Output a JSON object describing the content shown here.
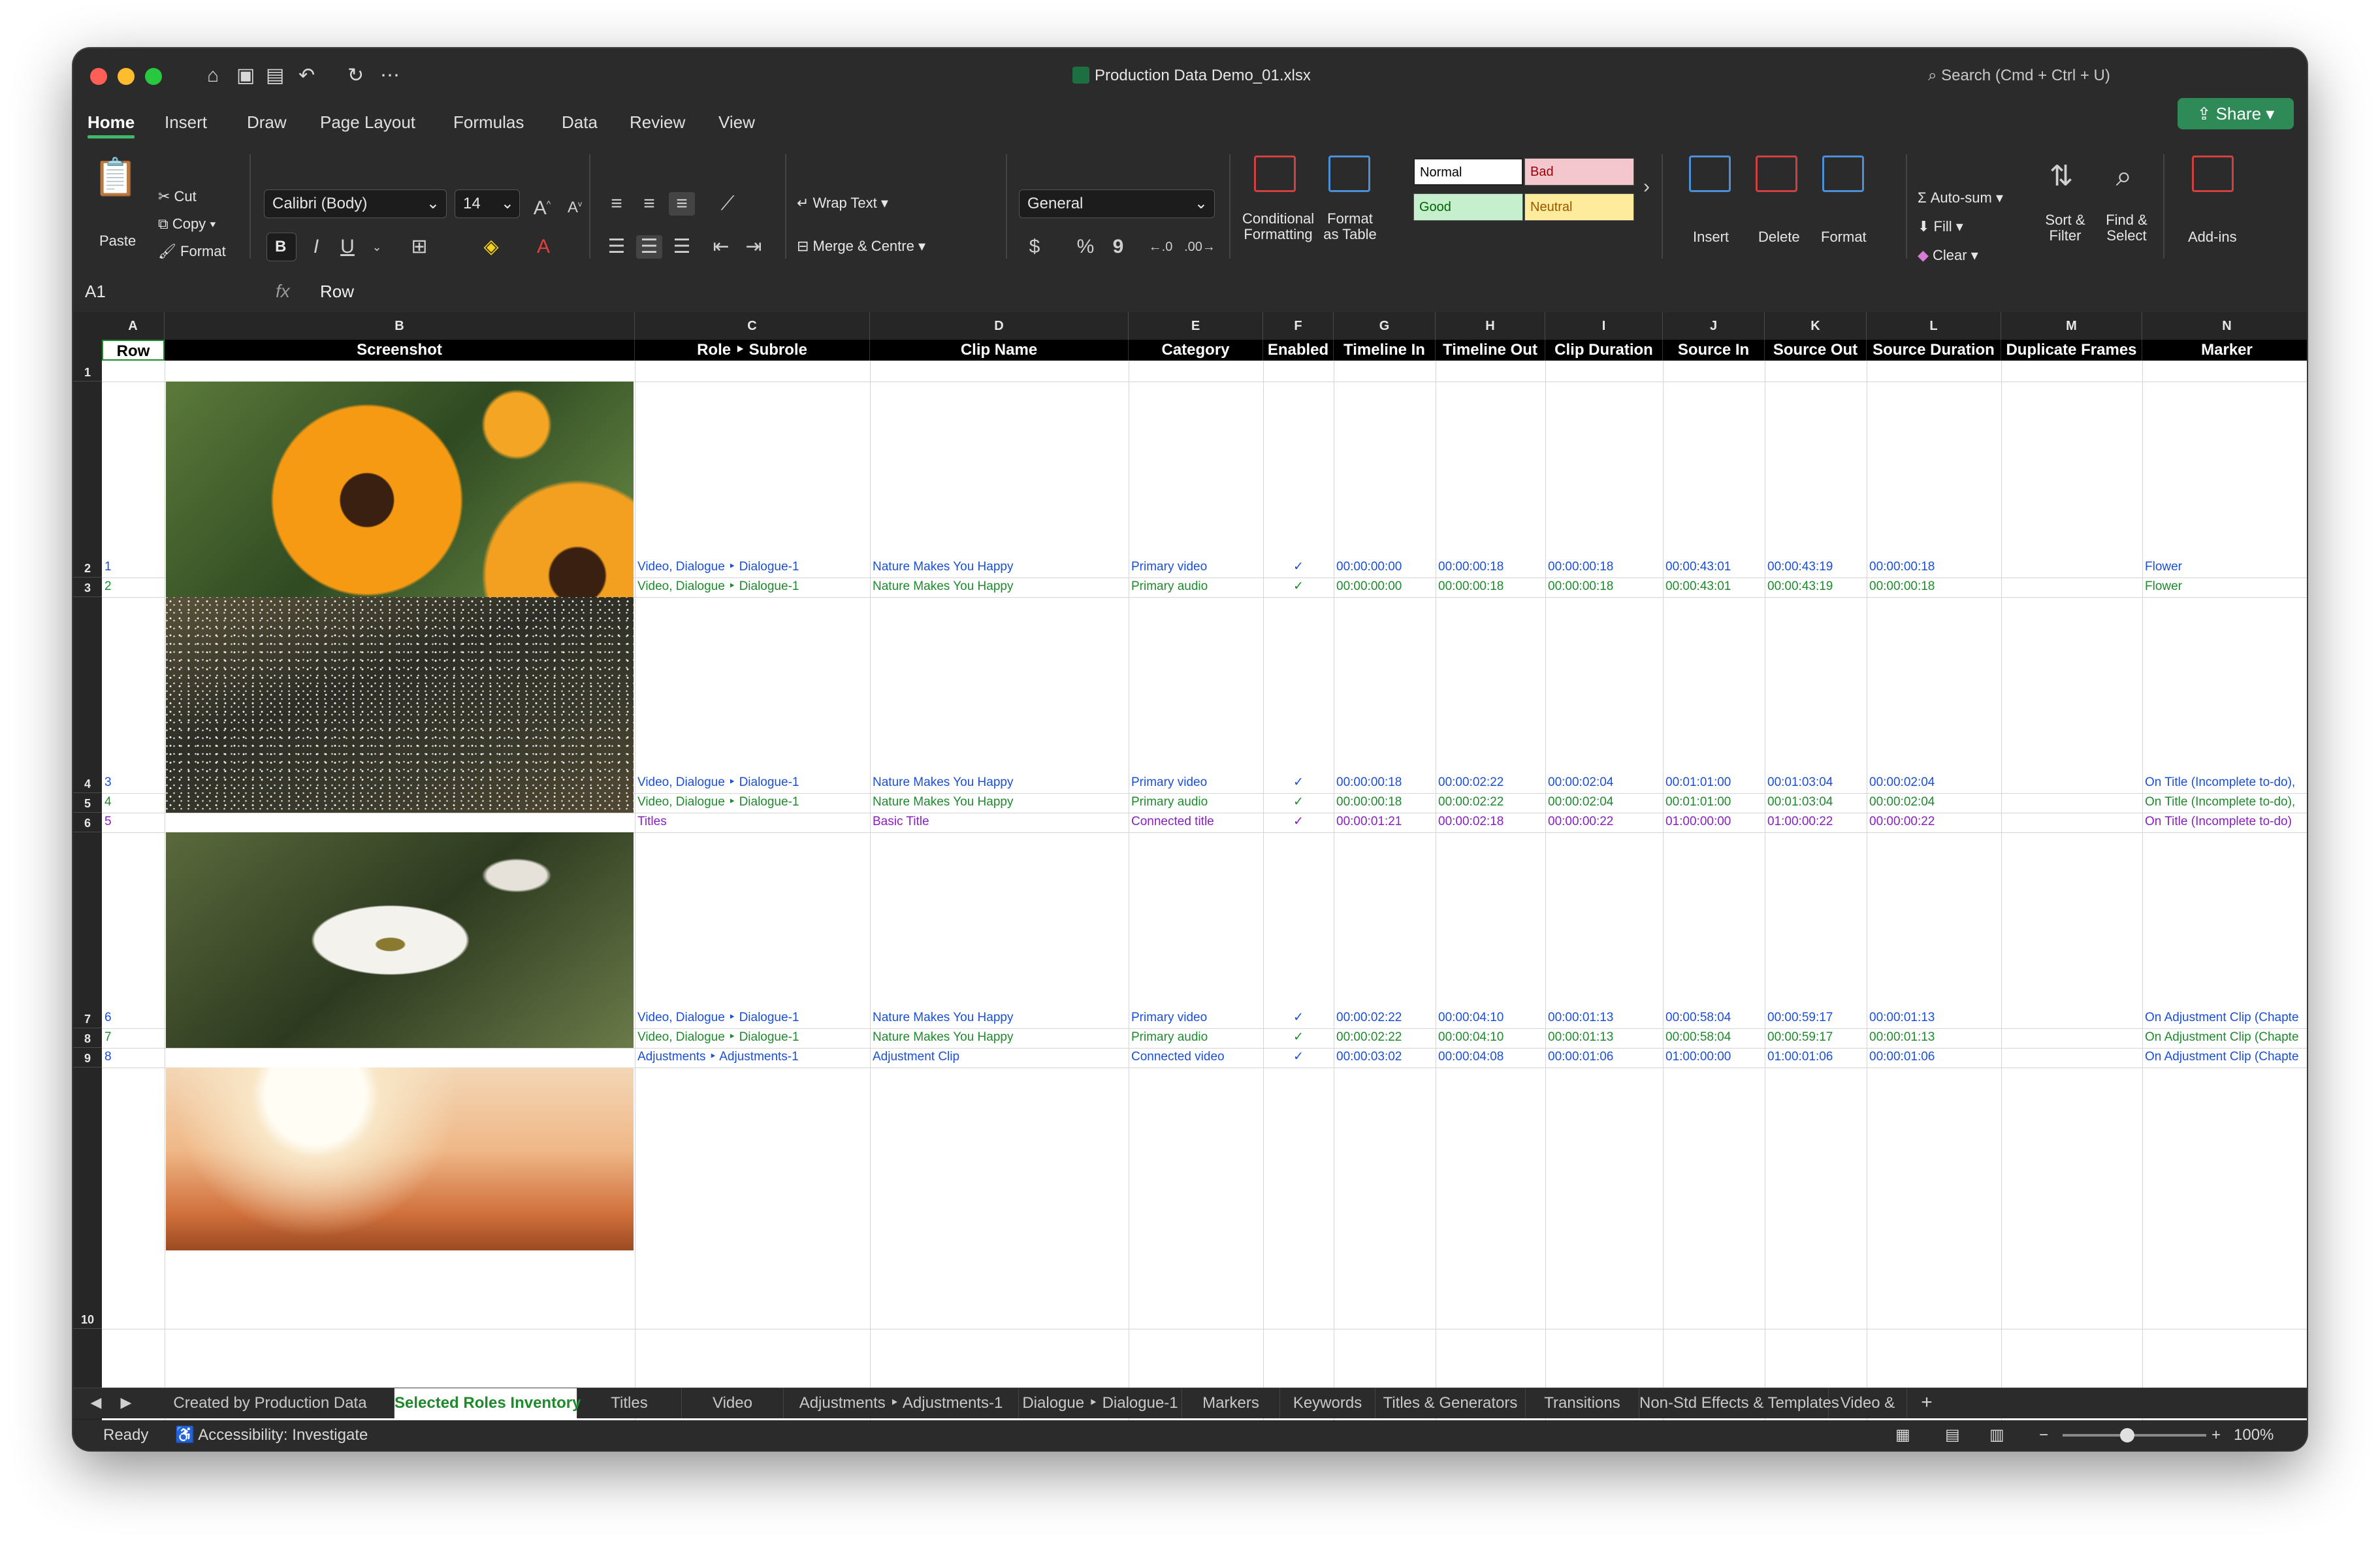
{
  "window": {
    "title": "Production Data Demo_01.xlsx",
    "search_placeholder": "Search (Cmd + Ctrl + U)"
  },
  "ribbon_tabs": [
    "Home",
    "Insert",
    "Draw",
    "Page Layout",
    "Formulas",
    "Data",
    "Review",
    "View"
  ],
  "share_label": "Share",
  "clipboard": {
    "paste": "Paste",
    "cut": "Cut",
    "copy": "Copy",
    "format": "Format"
  },
  "font": {
    "name": "Calibri (Body)",
    "size": "14",
    "bold": "B",
    "italic": "I",
    "underline": "U"
  },
  "alignment": {
    "wrap_text": "Wrap Text",
    "merge_centre": "Merge & Centre"
  },
  "number": {
    "format": "General",
    "currency": "$",
    "percent": "%",
    "comma": "9"
  },
  "styles": {
    "conditional_formatting": [
      "Conditional",
      "Formatting"
    ],
    "format_as_table": [
      "Format",
      "as Table"
    ],
    "normal": "Normal",
    "bad": "Bad",
    "good": "Good",
    "neutral": "Neutral"
  },
  "cells_group": {
    "insert": "Insert",
    "delete": "Delete",
    "format": "Format"
  },
  "editing": {
    "autosum": "Auto-sum",
    "fill": "Fill",
    "clear": "Clear",
    "sort_filter": [
      "Sort &",
      "Filter"
    ],
    "find_select": [
      "Find &",
      "Select"
    ]
  },
  "addins": "Add-ins",
  "formula_bar": {
    "name_box": "A1",
    "fx": "fx",
    "value": "Row"
  },
  "columns": [
    "A",
    "B",
    "C",
    "D",
    "E",
    "F",
    "G",
    "H",
    "I",
    "J",
    "K",
    "L",
    "M",
    "N"
  ],
  "headers": [
    "Row",
    "Screenshot",
    "Role ‣ Subrole",
    "Clip Name",
    "Category",
    "Enabled",
    "Timeline In",
    "Timeline Out",
    "Clip Duration",
    "Source In",
    "Source Out",
    "Source Duration",
    "Duplicate Frames",
    "Marker"
  ],
  "row_numbers": [
    "1",
    "2",
    "3",
    "4",
    "5",
    "6",
    "7",
    "8",
    "9",
    "10"
  ],
  "rows": [
    {
      "row": "1",
      "role": "Video, Dialogue ‣ Dialogue-1",
      "clip": "Nature Makes You Happy",
      "cat": "Primary video",
      "en": "✓",
      "tin": "00:00:00:00",
      "tout": "00:00:00:18",
      "dur": "00:00:00:18",
      "sin": "00:00:43:01",
      "sout": "00:00:43:19",
      "sdur": "00:00:00:18",
      "marker": "Flower",
      "color": "blue"
    },
    {
      "row": "2",
      "role": "Video, Dialogue ‣ Dialogue-1",
      "clip": "Nature Makes You Happy",
      "cat": "Primary audio",
      "en": "✓",
      "tin": "00:00:00:00",
      "tout": "00:00:00:18",
      "dur": "00:00:00:18",
      "sin": "00:00:43:01",
      "sout": "00:00:43:19",
      "sdur": "00:00:00:18",
      "marker": "Flower",
      "color": "green"
    },
    {
      "row": "3",
      "role": "Video, Dialogue ‣ Dialogue-1",
      "clip": "Nature Makes You Happy",
      "cat": "Primary video",
      "en": "✓",
      "tin": "00:00:00:18",
      "tout": "00:00:02:22",
      "dur": "00:00:02:04",
      "sin": "00:01:01:00",
      "sout": "00:01:03:04",
      "sdur": "00:00:02:04",
      "marker": "On Title (Incomplete to-do),",
      "color": "blue"
    },
    {
      "row": "4",
      "role": "Video, Dialogue ‣ Dialogue-1",
      "clip": "Nature Makes You Happy",
      "cat": "Primary audio",
      "en": "✓",
      "tin": "00:00:00:18",
      "tout": "00:00:02:22",
      "dur": "00:00:02:04",
      "sin": "00:01:01:00",
      "sout": "00:01:03:04",
      "sdur": "00:00:02:04",
      "marker": "On Title (Incomplete to-do),",
      "color": "green"
    },
    {
      "row": "5",
      "role": "Titles",
      "clip": "Basic Title",
      "cat": "Connected title",
      "en": "✓",
      "tin": "00:00:01:21",
      "tout": "00:00:02:18",
      "dur": "00:00:00:22",
      "sin": "01:00:00:00",
      "sout": "01:00:00:22",
      "sdur": "00:00:00:22",
      "marker": "On Title (Incomplete to-do)",
      "color": "purple"
    },
    {
      "row": "6",
      "role": "Video, Dialogue ‣ Dialogue-1",
      "clip": "Nature Makes You Happy",
      "cat": "Primary video",
      "en": "✓",
      "tin": "00:00:02:22",
      "tout": "00:00:04:10",
      "dur": "00:00:01:13",
      "sin": "00:00:58:04",
      "sout": "00:00:59:17",
      "sdur": "00:00:01:13",
      "marker": "On Adjustment Clip (Chapte",
      "color": "blue"
    },
    {
      "row": "7",
      "role": "Video, Dialogue ‣ Dialogue-1",
      "clip": "Nature Makes You Happy",
      "cat": "Primary audio",
      "en": "✓",
      "tin": "00:00:02:22",
      "tout": "00:00:04:10",
      "dur": "00:00:01:13",
      "sin": "00:00:58:04",
      "sout": "00:00:59:17",
      "sdur": "00:00:01:13",
      "marker": "On Adjustment Clip (Chapte",
      "color": "green"
    },
    {
      "row": "8",
      "role": "Adjustments ‣ Adjustments-1",
      "clip": "Adjustment Clip",
      "cat": "Connected video",
      "en": "✓",
      "tin": "00:00:03:02",
      "tout": "00:00:04:08",
      "dur": "00:00:01:06",
      "sin": "01:00:00:00",
      "sout": "01:00:01:06",
      "sdur": "00:00:01:06",
      "marker": "On Adjustment Clip (Chapte",
      "color": "blue"
    }
  ],
  "sheet_tabs": [
    "Created by Production Data",
    "Selected Roles Inventory",
    "Titles",
    "Video",
    "Adjustments ‣ Adjustments-1",
    "Dialogue ‣ Dialogue-1",
    "Markers",
    "Keywords",
    "Titles & Generators",
    "Transitions",
    "Non-Std Effects & Templates",
    "Video &"
  ],
  "status": {
    "ready": "Ready",
    "accessibility": "Accessibility: Investigate",
    "zoom": "100%"
  },
  "colors": {
    "blue": "#1a4fd6",
    "green": "#1e8a2b",
    "purple": "#8a1fbf",
    "accent": "#2e8b57"
  }
}
